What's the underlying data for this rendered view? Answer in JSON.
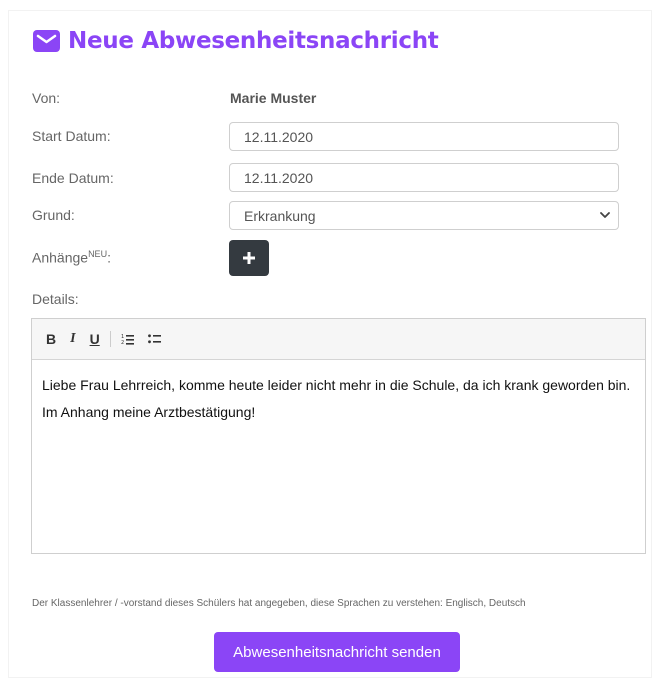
{
  "header": {
    "title": "Neue Abwesenheitsnachricht",
    "icon": "envelope-icon",
    "accent_color": "#8b45f6"
  },
  "form": {
    "from": {
      "label": "Von:",
      "value": "Marie Muster"
    },
    "start_date": {
      "label": "Start Datum:",
      "value": "12.11.2020"
    },
    "end_date": {
      "label": "Ende Datum:",
      "value": "12.11.2020"
    },
    "reason": {
      "label": "Grund:",
      "selected": "Erkrankung",
      "icon": "chevron-down-icon"
    },
    "attachments": {
      "label": "Anhänge",
      "badge": "NEU",
      "suffix": ":",
      "button_icon": "plus-icon"
    },
    "details": {
      "label": "Details:"
    }
  },
  "editor": {
    "toolbar": {
      "bold": "B",
      "italic": "I",
      "underline": "U",
      "ordered_list_icon": "ordered-list-icon",
      "bullet_list_icon": "bullet-list-icon"
    },
    "paragraphs": [
      "Liebe Frau Lehrreich, komme heute leider nicht mehr in die Schule, da ich krank geworden bin.",
      "Im Anhang meine Arztbestätigung!"
    ]
  },
  "note": "Der Klassenlehrer / -vorstand dieses Schülers hat angegeben, diese Sprachen zu verstehen: Englisch, Deutsch",
  "submit_label": "Abwesenheitsnachricht senden"
}
